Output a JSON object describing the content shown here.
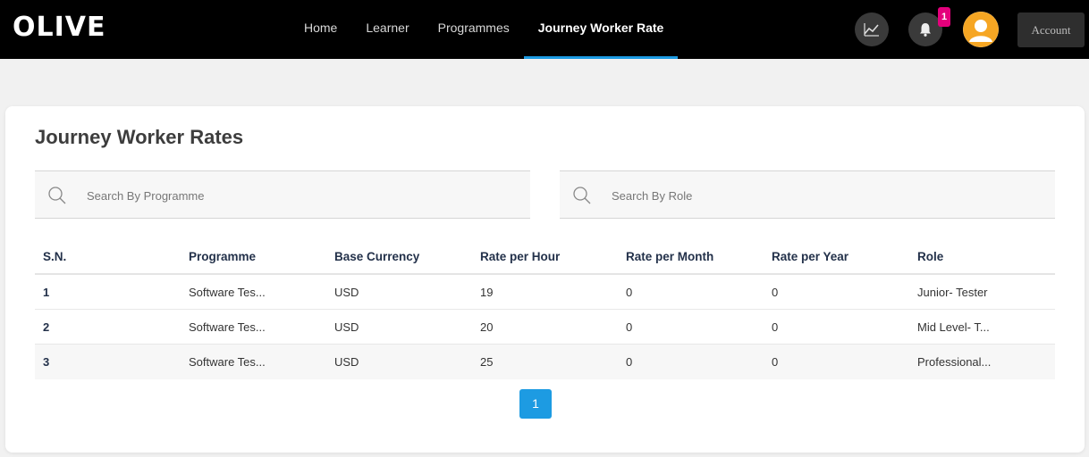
{
  "header": {
    "logo": "OLIVE",
    "nav": [
      {
        "label": "Home"
      },
      {
        "label": "Learner"
      },
      {
        "label": "Programmes"
      },
      {
        "label": "Journey Worker Rate",
        "active": true
      }
    ],
    "notification_count": "1",
    "account_label": "Account",
    "icons": [
      "chart-icon",
      "bell-icon",
      "user-avatar"
    ],
    "accent_color": "#1d9be2",
    "badge_color": "#e4007c"
  },
  "main": {
    "title": "Journey Worker Rates",
    "search_programme": {
      "placeholder": "Search By Programme",
      "value": ""
    },
    "search_role": {
      "placeholder": "Search By Role",
      "value": ""
    },
    "table": {
      "columns": [
        "S.N.",
        "Programme",
        "Base Currency",
        "Rate per Hour",
        "Rate per Month",
        "Rate per Year",
        "Role"
      ],
      "rows": [
        [
          "1",
          "Software Tes...",
          "USD",
          "19",
          "0",
          "0",
          "Junior- Tester"
        ],
        [
          "2",
          "Software Tes...",
          "USD",
          "20",
          "0",
          "0",
          "Mid Level- T..."
        ],
        [
          "3",
          "Software Tes...",
          "USD",
          "25",
          "0",
          "0",
          "Professional..."
        ]
      ]
    },
    "pagination": {
      "current_page": "1"
    }
  }
}
